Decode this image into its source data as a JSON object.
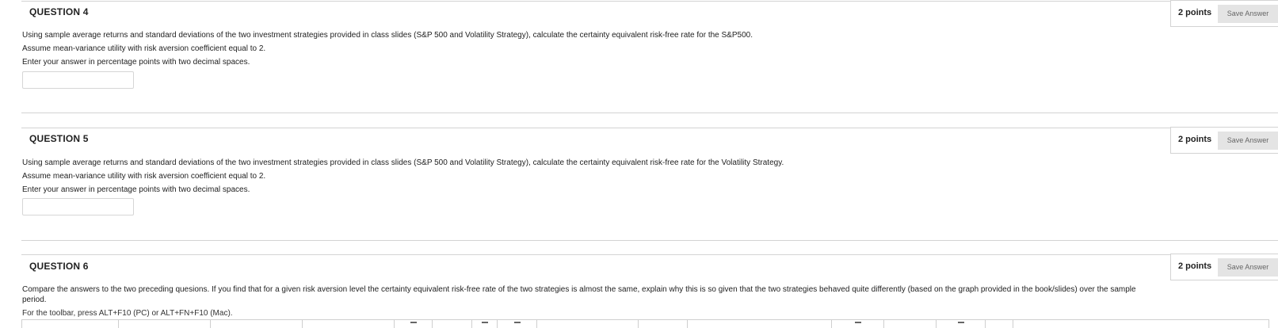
{
  "questions": [
    {
      "title": "QUESTION 4",
      "points": "2 points",
      "save_label": "Save Answer",
      "lines": [
        "Using sample average returns and standard deviations of the two investment strategies provided in class slides (S&P 500 and Volatility Strategy), calculate the certainty equivalent risk-free rate for the S&P500.",
        "Assume mean-variance utility with risk aversion coefficient equal to 2.",
        "Enter your answer in percentage points with two decimal spaces."
      ],
      "answer_value": ""
    },
    {
      "title": "QUESTION 5",
      "points": "2 points",
      "save_label": "Save Answer",
      "lines": [
        "Using sample average returns and standard deviations of the two investment strategies provided in class slides (S&P 500 and Volatility Strategy), calculate the certainty equivalent risk-free rate for the Volatility Strategy.",
        "Assume mean-variance utility with risk aversion coefficient equal to 2.",
        "Enter your answer in percentage points with two decimal spaces."
      ],
      "answer_value": ""
    },
    {
      "title": "QUESTION 6",
      "points": "2 points",
      "save_label": "Save Answer",
      "lines": [
        "Compare the answers to the two preceding quesions. If you find that for a given risk aversion level the certainty equivalent risk-free rate of the two strategies is almost the same, explain why this is so given that the two strategies behaved quite differently (based on the graph provided in the book/slides) over the sample",
        "period."
      ],
      "toolbar_hint": "For the toolbar, press ALT+F10 (PC) or ALT+FN+F10 (Mac)."
    }
  ]
}
